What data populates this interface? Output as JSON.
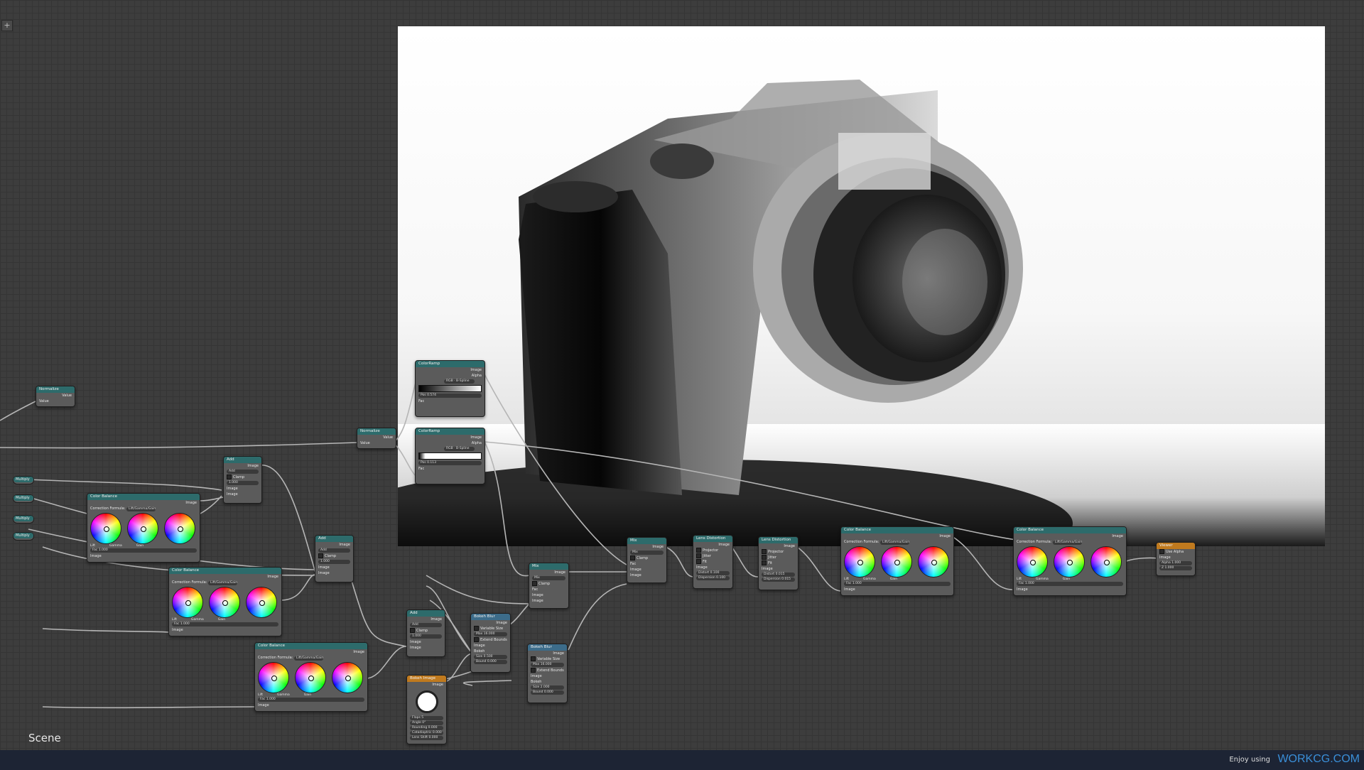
{
  "editor": {
    "scene_label": "Scene",
    "add_button": "+"
  },
  "status_bar": {
    "enjoy_text": "Enjoy using",
    "brand": "WORKCG.COM"
  },
  "labels": {
    "value": "Value",
    "image": "Image",
    "alpha": "Alpha",
    "fac": "Fac",
    "clamp": "Clamp",
    "correction_formula": "Correction Formula:",
    "lgg": "Lift/Gamma/Gain",
    "lift": "Lift",
    "gamma": "Gamma",
    "gain": "Gain",
    "rgb": "RGB",
    "b_spline": "B-Spline",
    "pos": "Pos",
    "bokeh": "Bokeh",
    "variable_size": "Variable Size",
    "extend_bounds": "Extend Bounds",
    "projector": "Projector",
    "jitter": "Jitter",
    "fit": "Fit",
    "use_alpha": "Use Alpha",
    "add": "Add",
    "mix": "Mix"
  },
  "nodes": {
    "normalize_1": {
      "title": "Normalize"
    },
    "normalize_2": {
      "title": "Normalize"
    },
    "colorramp_1": {
      "title": "ColorRamp",
      "pos_value": "0.574"
    },
    "colorramp_2": {
      "title": "ColorRamp",
      "pos_value": "0.113"
    },
    "multiply": {
      "title": "Multiply"
    },
    "add_1": {
      "title": "Add",
      "fac": "1.000"
    },
    "add_2": {
      "title": "Add",
      "fac": "1.000"
    },
    "add_3": {
      "title": "Add",
      "fac": "1.000"
    },
    "color_balance_1": {
      "title": "Color Balance",
      "fac": "1.000"
    },
    "color_balance_2": {
      "title": "Color Balance",
      "fac": "1.000"
    },
    "color_balance_3": {
      "title": "Color Balance",
      "fac": "1.000"
    },
    "color_balance_4": {
      "title": "Color Balance",
      "fac": "1.000"
    },
    "color_balance_5": {
      "title": "Color Balance",
      "fac": "1.000"
    },
    "mix_1": {
      "title": "Mix"
    },
    "mix_2": {
      "title": "Mix"
    },
    "bokeh_blur_1": {
      "title": "Bokeh Blur",
      "max_blur": "Max 16.000",
      "size": "Size 0.500",
      "bounding": "Bound 0.000"
    },
    "bokeh_blur_2": {
      "title": "Bokeh Blur",
      "max_blur": "Max 16.000",
      "size": "Size 2.000",
      "bounding": "Bound 0.000"
    },
    "bokeh_image": {
      "title": "Bokeh Image",
      "flaps": "Flaps 5",
      "angle": "Angle 0°",
      "rounding": "Rounding 0.000",
      "catadioptric": "Catadioptric 0.000",
      "lens_shift": "Lens Shift 0.000"
    },
    "lens_distortion_1": {
      "title": "Lens Distortion",
      "distort": "Distort 0.100",
      "dispersion": "Dispersion 0.100"
    },
    "lens_distortion_2": {
      "title": "Lens Distortion",
      "distort": "Distort 0.015",
      "dispersion": "Dispersion 0.015"
    },
    "viewer": {
      "title": "Viewer",
      "alpha": "Alpha 1.000",
      "z": "Z 1.000"
    }
  },
  "colors": {
    "node_header": "#2d6b6b",
    "viewer_header": "#c07a1e",
    "socket": "#c7c729",
    "wire": "#b5b5b5",
    "brand": "#3a8fd8",
    "status_bg": "#1d2434"
  }
}
